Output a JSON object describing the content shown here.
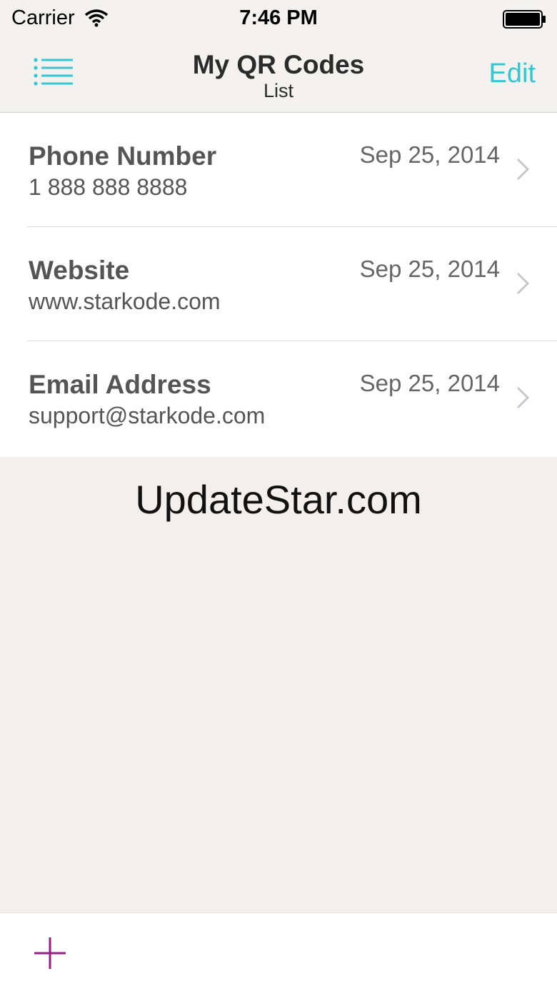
{
  "status_bar": {
    "carrier": "Carrier",
    "time": "7:46 PM",
    "wifi_icon": "wifi-icon",
    "battery_icon": "battery-icon"
  },
  "nav": {
    "title": "My QR Codes",
    "subtitle": "List",
    "edit_label": "Edit",
    "menu_icon": "list-menu-icon"
  },
  "items": [
    {
      "title": "Phone Number",
      "value": "1 888 888 8888",
      "date": "Sep 25, 2014"
    },
    {
      "title": "Website",
      "value": "www.starkode.com",
      "date": "Sep 25, 2014"
    },
    {
      "title": "Email Address",
      "value": "support@starkode.com",
      "date": "Sep 25, 2014"
    }
  ],
  "watermark": "UpdateStar.com",
  "toolbar": {
    "add_icon": "plus-icon"
  },
  "colors": {
    "accent": "#37c4d3",
    "add": "#9b1b8a",
    "background": "#f2efec"
  }
}
